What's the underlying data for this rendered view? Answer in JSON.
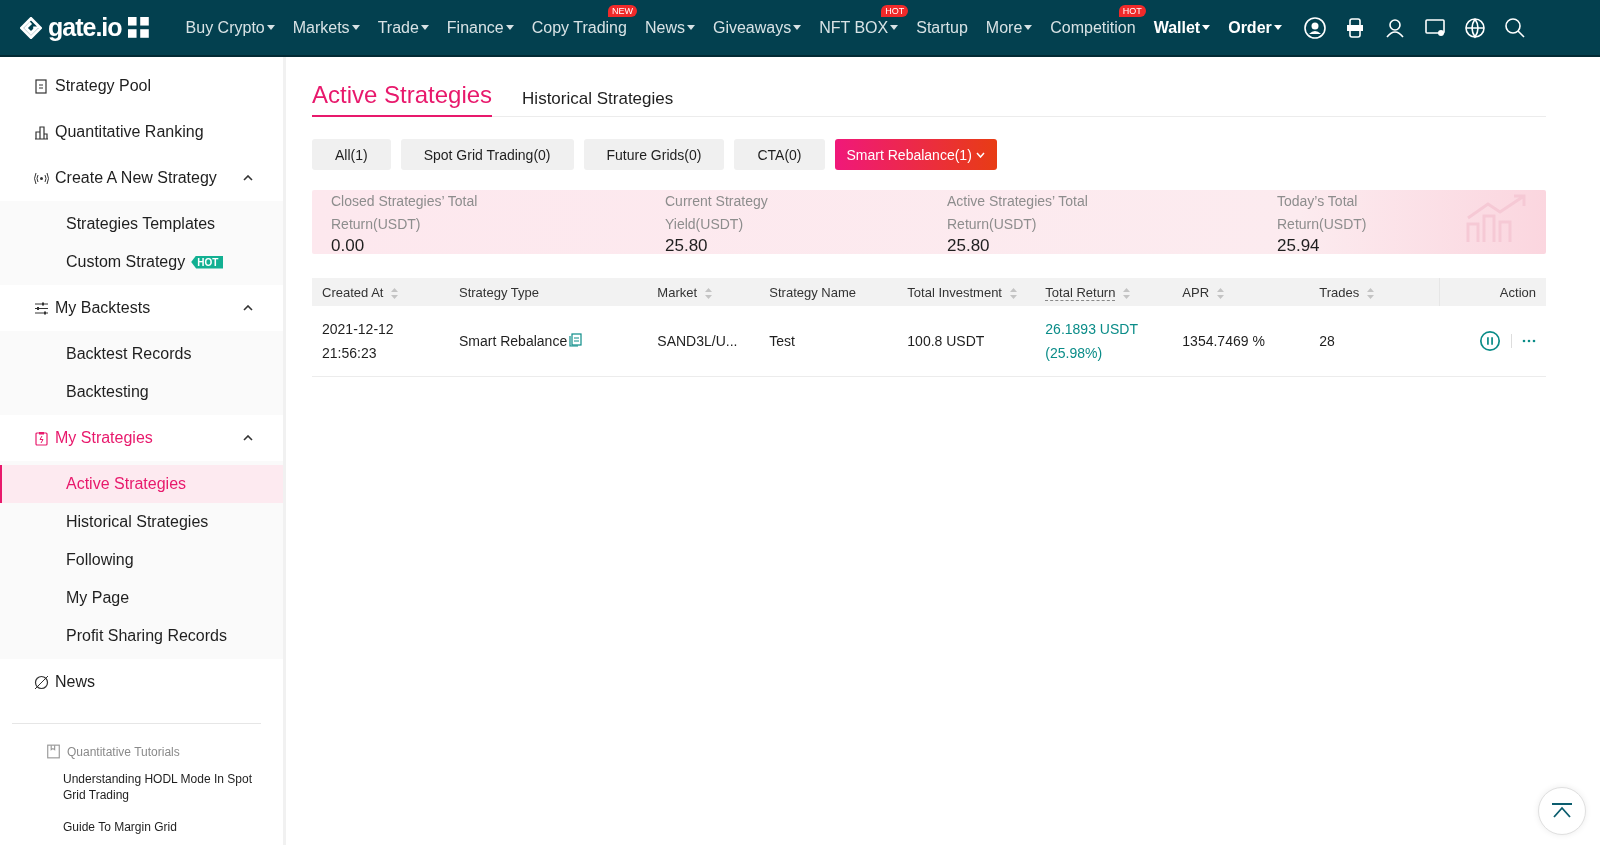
{
  "header": {
    "logo": "gate.io",
    "nav": [
      {
        "label": "Buy Crypto",
        "dropdown": true,
        "bold": false
      },
      {
        "label": "Markets",
        "dropdown": true,
        "bold": false
      },
      {
        "label": "Trade",
        "dropdown": true,
        "bold": false
      },
      {
        "label": "Finance",
        "dropdown": true,
        "bold": false
      },
      {
        "label": "Copy Trading",
        "dropdown": false,
        "bold": false,
        "badge": "NEW"
      },
      {
        "label": "News",
        "dropdown": true,
        "bold": false
      },
      {
        "label": "Giveaways",
        "dropdown": true,
        "bold": false
      },
      {
        "label": "NFT BOX",
        "dropdown": true,
        "bold": false,
        "badge": "HOT"
      },
      {
        "label": "Startup",
        "dropdown": false,
        "bold": false
      },
      {
        "label": "More",
        "dropdown": true,
        "bold": false
      },
      {
        "label": "Competition",
        "dropdown": false,
        "bold": false,
        "badge": "HOT"
      },
      {
        "label": "Wallet",
        "dropdown": true,
        "bold": true
      },
      {
        "label": "Order",
        "dropdown": true,
        "bold": true
      }
    ]
  },
  "sidebar": {
    "items": [
      {
        "label": "Strategy Pool",
        "selected": false
      },
      {
        "label": "Quantitative Ranking",
        "selected": false
      },
      {
        "label": "Create A New Strategy",
        "selected": false,
        "expanded": true,
        "children": [
          {
            "label": "Strategies Templates",
            "selected": false
          },
          {
            "label": "Custom Strategy",
            "selected": false,
            "badge": "HOT"
          }
        ]
      },
      {
        "label": "My Backtests",
        "selected": false,
        "expanded": true,
        "children": [
          {
            "label": "Backtest Records",
            "selected": false
          },
          {
            "label": "Backtesting",
            "selected": false
          }
        ]
      },
      {
        "label": "My Strategies",
        "selected": true,
        "expanded": true,
        "children": [
          {
            "label": "Active Strategies",
            "selected": true
          },
          {
            "label": "Historical Strategies",
            "selected": false
          },
          {
            "label": "Following",
            "selected": false
          },
          {
            "label": "My Page",
            "selected": false
          },
          {
            "label": "Profit Sharing Records",
            "selected": false
          }
        ]
      },
      {
        "label": "News",
        "selected": false
      }
    ],
    "tutorials": {
      "title": "Quantitative Tutorials",
      "links": [
        "Understanding HODL Mode In Spot Grid Trading",
        "Guide To Margin Grid"
      ]
    }
  },
  "tabs": [
    {
      "label": "Active Strategies",
      "selected": true
    },
    {
      "label": "Historical Strategies",
      "selected": false
    }
  ],
  "filters": [
    {
      "label": "All(1)",
      "selected": false,
      "dropdown": false
    },
    {
      "label": "Spot Grid Trading(0)",
      "selected": false,
      "dropdown": false
    },
    {
      "label": "Future Grids(0)",
      "selected": false,
      "dropdown": false
    },
    {
      "label": "CTA(0)",
      "selected": false,
      "dropdown": false
    },
    {
      "label": "Smart Rebalance(1)",
      "selected": true,
      "dropdown": true
    }
  ],
  "summary": [
    {
      "label": "Closed Strategies’ Total Return(USDT)",
      "value": "0.00"
    },
    {
      "label": "Current Strategy Yield(USDT)",
      "value": "25.80"
    },
    {
      "label": "Active Strategies’ Total Return(USDT)",
      "value": "25.80"
    },
    {
      "label": "Today’s Total Return(USDT)",
      "value": "25.94"
    }
  ],
  "table": {
    "columns": [
      {
        "label": "Created At",
        "sortable": true
      },
      {
        "label": "Strategy Type",
        "sortable": false
      },
      {
        "label": "Market",
        "sortable": true
      },
      {
        "label": "Strategy Name",
        "sortable": false
      },
      {
        "label": "Total Investment",
        "sortable": true
      },
      {
        "label": "Total Return",
        "sortable": true,
        "hint": true
      },
      {
        "label": "APR",
        "sortable": true
      },
      {
        "label": "Trades",
        "sortable": true
      },
      {
        "label": "Action",
        "sortable": false
      }
    ],
    "rows": [
      {
        "created_at": "2021-12-12 21:56:23",
        "strategy_type": "Smart Rebalance",
        "market": "SAND3L/U...",
        "strategy_name": "Test",
        "total_investment": "100.8 USDT",
        "total_return": "26.1893 USDT (25.98%)",
        "apr": "1354.7469 %",
        "trades": "28"
      }
    ]
  }
}
